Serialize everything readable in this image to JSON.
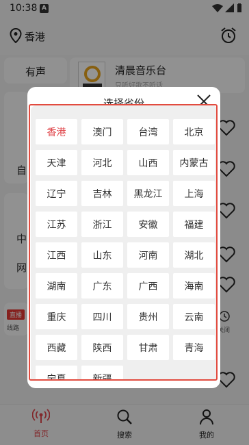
{
  "status_bar": {
    "time": "10:38",
    "notif_glyph": "A"
  },
  "header": {
    "location": "香港"
  },
  "tabs": {
    "youshen": "有声"
  },
  "station": {
    "name": "清晨音乐台",
    "subtitle": "只听好歌不听话"
  },
  "left_fragments": {
    "a": "自",
    "b": "中",
    "c": "网"
  },
  "player": {
    "live_badge": "直播",
    "line_text": "线路",
    "close_text": "关闭"
  },
  "bottom_nav": {
    "home": "首页",
    "search": "搜索",
    "mine": "我的"
  },
  "dialog": {
    "title": "选择省份",
    "provinces": [
      "香港",
      "澳门",
      "台湾",
      "北京",
      "天津",
      "河北",
      "山西",
      "内蒙古",
      "辽宁",
      "吉林",
      "黑龙江",
      "上海",
      "江苏",
      "浙江",
      "安徽",
      "福建",
      "江西",
      "山东",
      "河南",
      "湖北",
      "湖南",
      "广东",
      "广西",
      "海南",
      "重庆",
      "四川",
      "贵州",
      "云南",
      "西藏",
      "陕西",
      "甘肃",
      "青海",
      "宁夏",
      "新疆"
    ],
    "selected": "香港"
  },
  "colors": {
    "accent": "#e0474c",
    "highlight": "#e24b3f",
    "overlay": "rgba(0,0,0,0.42)"
  },
  "icons": [
    "location-pin-icon",
    "alarm-clock-icon",
    "heart-icon",
    "close-icon",
    "playlist-icon",
    "play-icon",
    "skip-next-icon",
    "home-radio-icon",
    "search-icon",
    "user-icon"
  ]
}
